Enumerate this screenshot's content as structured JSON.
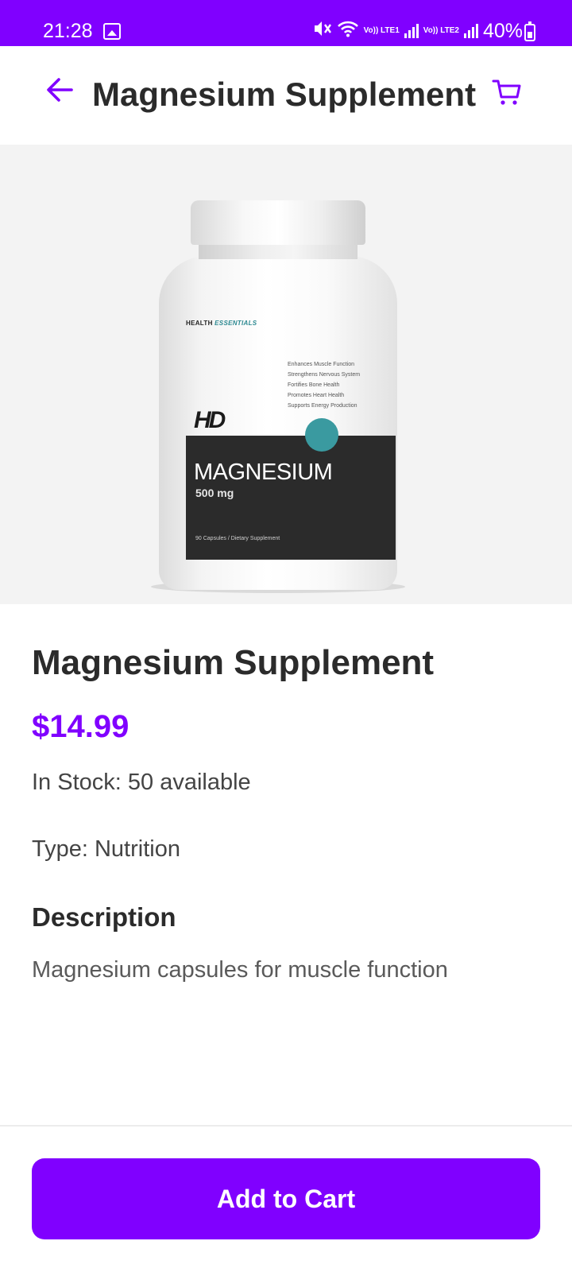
{
  "status_bar": {
    "time": "21:28",
    "battery": "40%",
    "network_1": "Vo)) LTE1",
    "network_2": "Vo)) LTE2",
    "icons": [
      "gallery-icon",
      "mute-icon",
      "wifi-icon",
      "signal-icon",
      "battery-icon"
    ]
  },
  "app_bar": {
    "title": "Magnesium Supplement",
    "back_icon": "arrow-left-icon",
    "cart_icon": "cart-icon"
  },
  "product_image": {
    "brand_prefix": "HEALTH ",
    "brand_suffix": "ESSENTIALS",
    "logo": "HD",
    "name": "MAGNESIUM",
    "dose": "500 mg",
    "benefits": [
      "Enhances Muscle Function",
      "Strengthens Nervous System",
      "Fortifies Bone Health",
      "Promotes Heart Health",
      "Supports Energy Production"
    ],
    "footer": "90 Capsules / Dietary Supplement"
  },
  "product": {
    "name": "Magnesium Supplement",
    "price": "$14.99",
    "stock": "In Stock: 50 available",
    "type": "Type: Nutrition",
    "description_heading": "Description",
    "description": "Magnesium capsules for muscle function"
  },
  "actions": {
    "add_to_cart": "Add to Cart"
  },
  "colors": {
    "accent": "#8000ff",
    "text": "#2b2b2b",
    "muted": "#5a5a5a",
    "image_bg": "#f3f3f3"
  }
}
